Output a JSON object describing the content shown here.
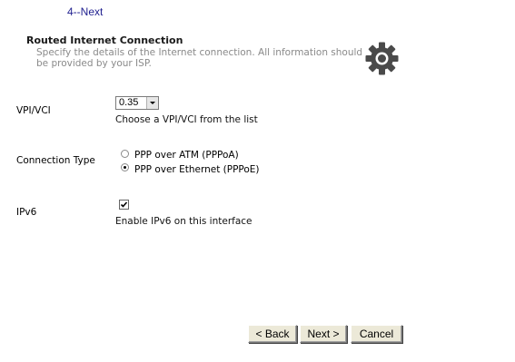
{
  "wizard": {
    "step_link": "4--Next"
  },
  "section": {
    "title": "Routed Internet Connection",
    "description": "Specify the details of the Internet connection. All information should be provided by your ISP."
  },
  "fields": {
    "vpi_vci": {
      "label": "VPI/VCI",
      "selected": "0.35",
      "help": "Choose a VPI/VCI from the list"
    },
    "connection_type": {
      "label": "Connection Type",
      "options": [
        {
          "label": "PPP over ATM (PPPoA)",
          "checked": false
        },
        {
          "label": "PPP over Ethernet (PPPoE)",
          "checked": true
        }
      ]
    },
    "ipv6": {
      "label": "IPv6",
      "checked": true,
      "help": "Enable IPv6 on this interface"
    }
  },
  "buttons": {
    "back": "< Back",
    "next": "Next >",
    "cancel": "Cancel"
  },
  "icons": {
    "gear": "gear-icon",
    "select_arrow": "chevron-down-icon",
    "checkmark": "checkmark-icon"
  },
  "colors": {
    "link": "#1f1f8f",
    "description": "#8a8a8a",
    "gear": "#4a4a4a",
    "button_face": "#ece9d8"
  }
}
